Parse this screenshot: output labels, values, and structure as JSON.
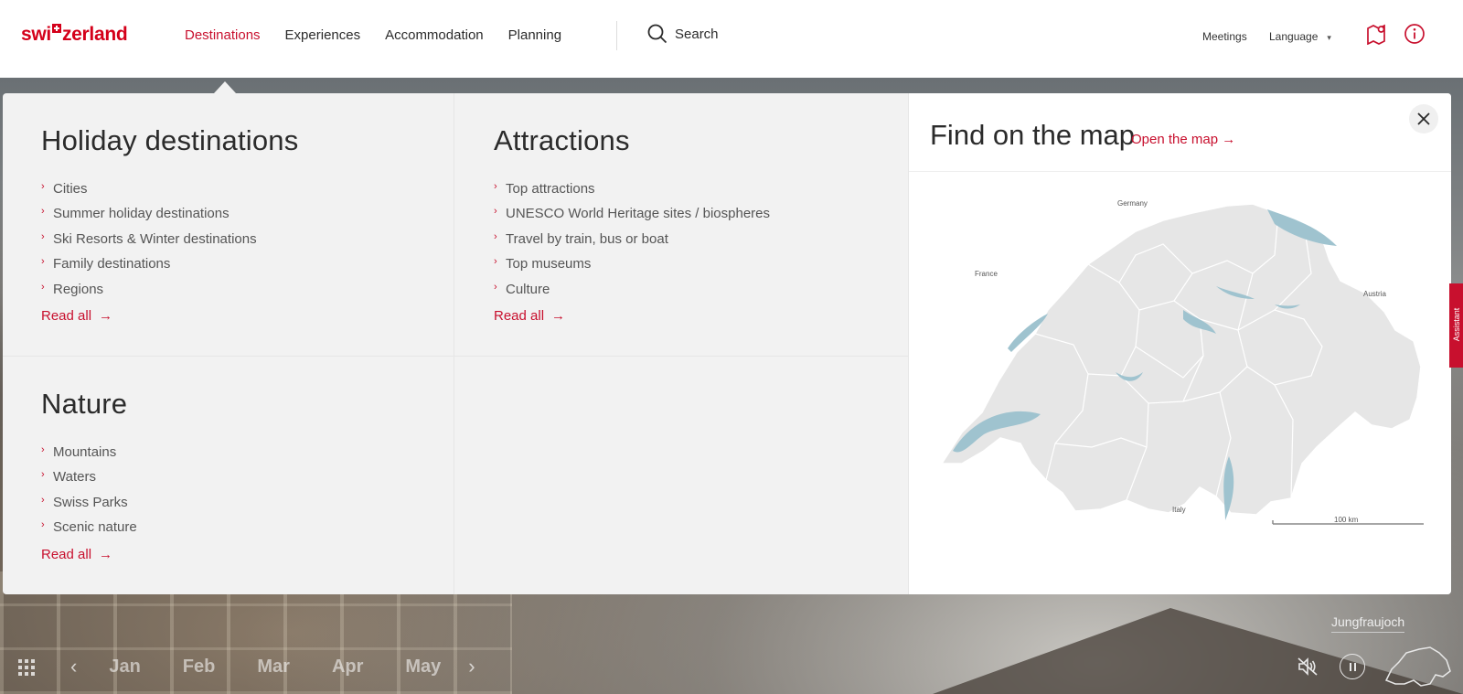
{
  "header": {
    "logo": {
      "left": "swi",
      "right": "zerland"
    },
    "nav": [
      {
        "label": "Destinations",
        "active": true
      },
      {
        "label": "Experiences"
      },
      {
        "label": "Accommodation"
      },
      {
        "label": "Planning"
      }
    ],
    "search_label": "Search",
    "meetings_label": "Meetings",
    "language_label": "Language",
    "language_caret": "▾",
    "icons": [
      "map-pin-icon",
      "info-icon"
    ]
  },
  "menu": {
    "holiday": {
      "title": "Holiday destinations",
      "items": [
        "Cities",
        "Summer holiday destinations",
        "Ski Resorts & Winter destinations",
        "Family destinations",
        "Regions"
      ],
      "read_all": "Read all"
    },
    "attractions": {
      "title": "Attractions",
      "items": [
        "Top attractions",
        "UNESCO World Heritage sites / biospheres",
        "Travel by train, bus or boat",
        "Top museums",
        "Culture"
      ],
      "read_all": "Read all"
    },
    "nature": {
      "title": "Nature",
      "items": [
        "Mountains",
        "Waters",
        "Swiss Parks",
        "Scenic nature"
      ],
      "read_all": "Read all"
    },
    "bullet": "›",
    "arrow": "→"
  },
  "map": {
    "title": "Find on the map",
    "open_link": "Open the map",
    "labels": {
      "germany": "Germany",
      "france": "France",
      "austria": "Austria",
      "italy": "Italy",
      "scale": "100 km"
    }
  },
  "bottom": {
    "months": [
      "Jan",
      "Feb",
      "Mar",
      "Apr",
      "May"
    ],
    "prev": "‹",
    "next": "›",
    "location": "Jungfraujoch",
    "assistant_label": "Assistant"
  },
  "colors": {
    "brand": "#c8102e",
    "lake": "#9fc3cf",
    "land": "#e6e6e6"
  }
}
